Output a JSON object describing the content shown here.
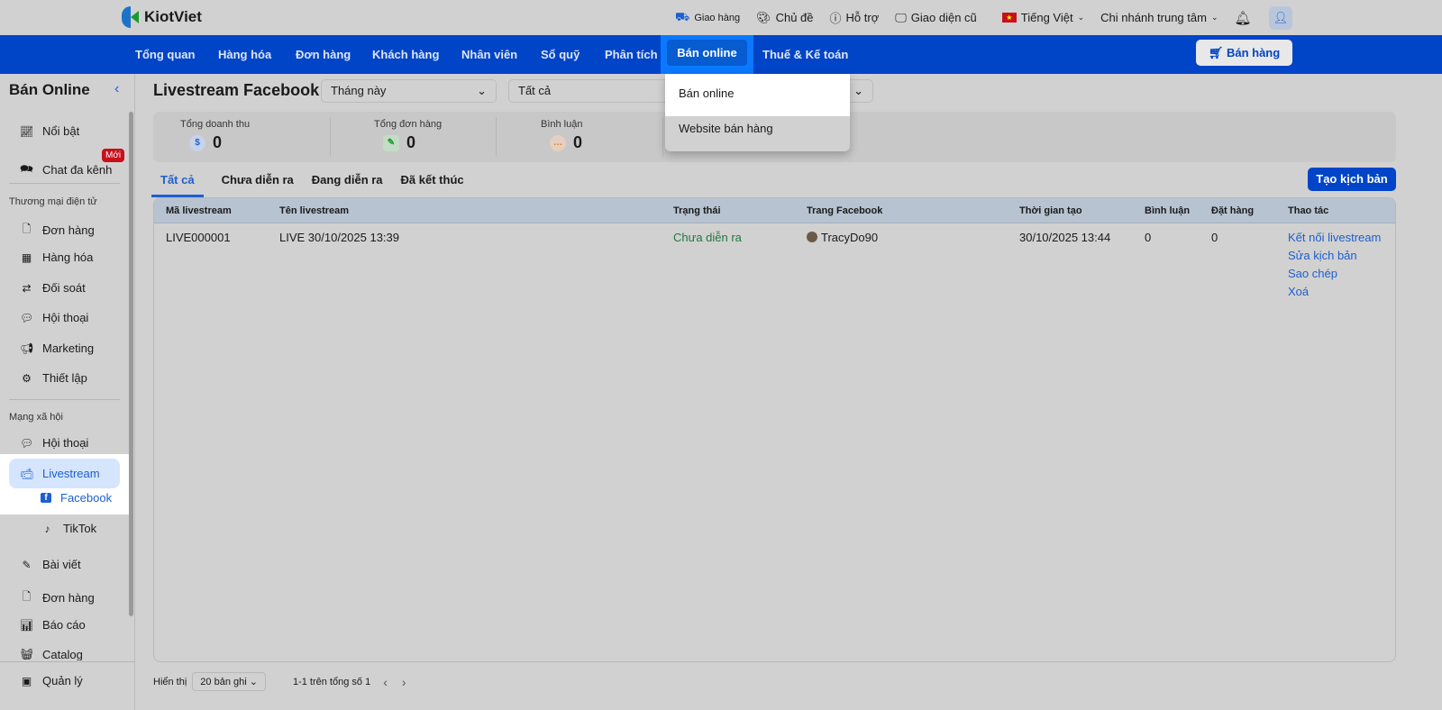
{
  "app": {
    "logo": "KiotViet"
  },
  "topbar": {
    "delivery": "Giao hàng",
    "theme": "Chủ đề",
    "support": "Hỗ trợ",
    "old_ui": "Giao diện cũ",
    "language": "Tiếng Việt",
    "branch": "Chi nhánh trung tâm"
  },
  "nav": {
    "items": [
      "Tổng quan",
      "Hàng hóa",
      "Đơn hàng",
      "Khách hàng",
      "Nhân viên",
      "Sổ quỹ",
      "Phân tích",
      "Bán online",
      "Thuế & Kế toán"
    ],
    "sell_button": "Bán hàng"
  },
  "dropdown": {
    "items": [
      "Bán online",
      "Website bán hàng"
    ]
  },
  "sidebar": {
    "title": "Bán Online",
    "new_badge": "Mới",
    "items": {
      "featured": "Nổi bật",
      "chat": "Chat đa kênh",
      "ecom_section": "Thương mại điện tử",
      "orders": "Đơn hàng",
      "products": "Hàng hóa",
      "reconcile": "Đối soát",
      "conversations": "Hội thoại",
      "marketing": "Marketing",
      "settings": "Thiết lập",
      "social_section": "Mạng xã hội",
      "social_conv": "Hội thoại",
      "livestream": "Livestream",
      "facebook": "Facebook",
      "tiktok": "TikTok",
      "posts": "Bài viết",
      "social_orders": "Đơn hàng",
      "reports": "Báo cáo",
      "catalog": "Catalog",
      "manage": "Quản lý"
    }
  },
  "main": {
    "title": "Livestream Facebook",
    "filter_period": "Tháng này",
    "filter_status": "Tất cả",
    "stats": [
      {
        "label": "Tổng doanh thu",
        "value": "0"
      },
      {
        "label": "Tổng đơn hàng",
        "value": "0"
      },
      {
        "label": "Bình luận",
        "value": "0"
      }
    ],
    "tabs": [
      "Tất cả",
      "Chưa diễn ra",
      "Đang diễn ra",
      "Đã kết thúc"
    ],
    "create_button": "Tạo kịch bản",
    "columns": [
      "Mã livestream",
      "Tên livestream",
      "Trạng thái",
      "Trang Facebook",
      "Thời gian tạo",
      "Bình luận",
      "Đặt hàng",
      "Thao tác"
    ],
    "rows": [
      {
        "code": "LIVE000001",
        "name": "LIVE 30/10/2025 13:39",
        "status": "Chưa diễn ra",
        "page": "TracyDo90",
        "created": "30/10/2025 13:44",
        "comments": "0",
        "orders": "0",
        "actions": [
          "Kết nối livestream",
          "Sửa kịch bản",
          "Sao chép",
          "Xoá"
        ]
      }
    ],
    "footer": {
      "show_label": "Hiển thị",
      "page_size": "20 bản ghi",
      "range": "1-1 trên tổng số 1"
    }
  }
}
